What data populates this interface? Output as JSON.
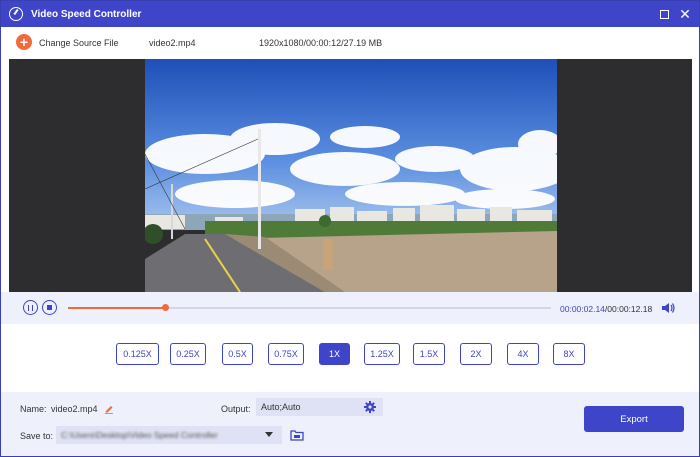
{
  "window": {
    "title": "Video Speed Controller"
  },
  "source": {
    "change_label": "Change Source File",
    "filename": "video2.mp4",
    "fileinfo": "1920x1080/00:00:12/27.19 MB"
  },
  "player": {
    "current_time": "00:00:02.14",
    "separator": "/",
    "total_time": "00:00:12.18",
    "progress": 0.2
  },
  "speeds": [
    {
      "label": "0.125X",
      "active": false
    },
    {
      "label": "0.25X",
      "active": false
    },
    {
      "label": "0.5X",
      "active": false
    },
    {
      "label": "0.75X",
      "active": false
    },
    {
      "label": "1X",
      "active": true
    },
    {
      "label": "1.25X",
      "active": false
    },
    {
      "label": "1.5X",
      "active": false
    },
    {
      "label": "2X",
      "active": false
    },
    {
      "label": "4X",
      "active": false
    },
    {
      "label": "8X",
      "active": false
    }
  ],
  "settings": {
    "name_label": "Name:",
    "name_value": "video2.mp4",
    "output_label": "Output:",
    "output_value": "Auto;Auto",
    "saveto_label": "Save to:",
    "saveto_value": "C:\\Users\\Desktop\\Video Speed Controller",
    "export_label": "Export"
  },
  "colors": {
    "accent": "#3f45c8",
    "orange": "#f06a3a",
    "panel": "#eef0fc"
  }
}
